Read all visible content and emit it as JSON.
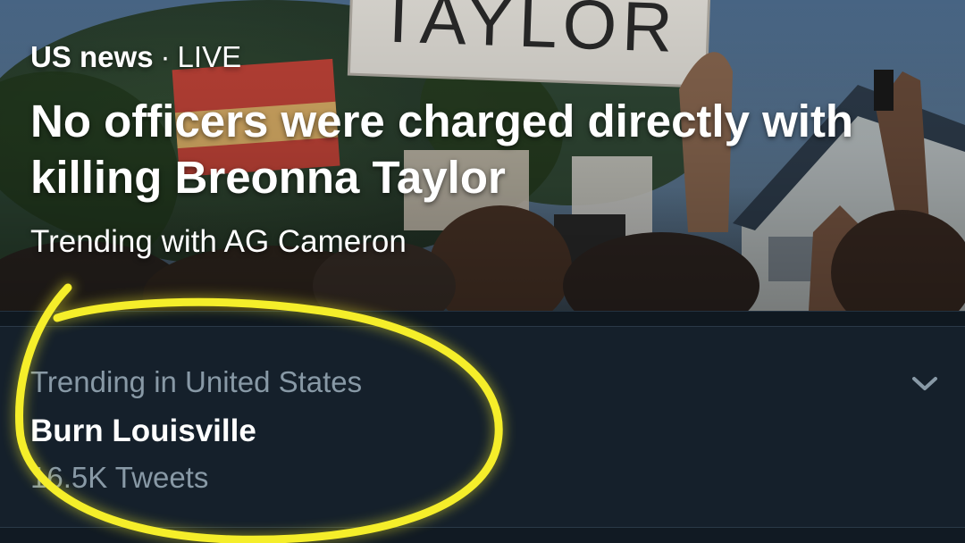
{
  "hero": {
    "category": "US news",
    "separator": "·",
    "status": "LIVE",
    "headline": "No officers were charged directly with killing Breonna Taylor",
    "subtitle": "Trending with AG Cameron",
    "photo_sign_text": "TAYLOR"
  },
  "trend": {
    "context": "Trending in United States",
    "name": "Burn Louisville",
    "count": "16.5K Tweets",
    "more_icon": "chevron-down-icon"
  },
  "colors": {
    "background": "#15202b",
    "secondary_text": "#8899a6",
    "primary_text": "#ffffff",
    "highlight": "#f5ee2a"
  }
}
